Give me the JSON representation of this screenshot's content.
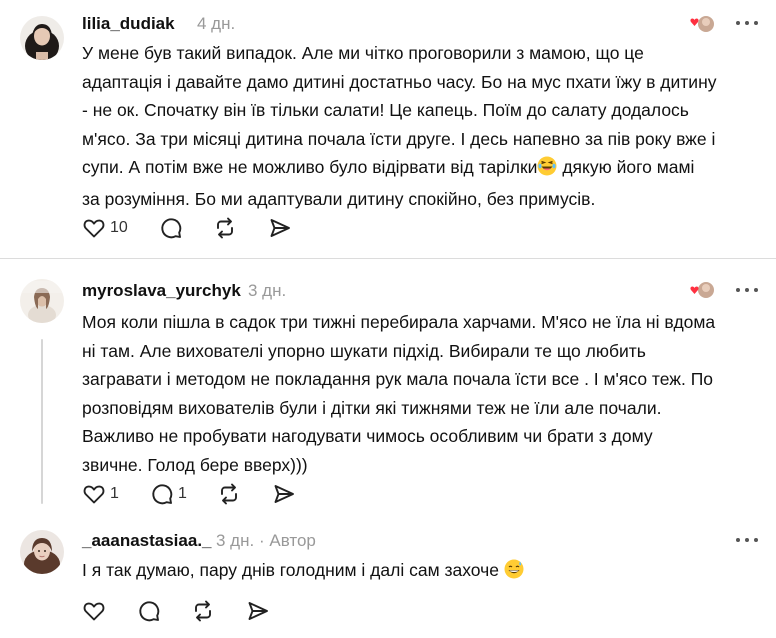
{
  "comments": [
    {
      "username": "lilia_dudiak",
      "time": "4 дн.",
      "text": "У мене був такий випадок. Але ми чітко проговорили з мамою, що це\nадаптація і давайте дамо дитині достатньо часу. Бо на мус пхати їжу в дитину\n- не ок. Спочатку він їв тільки салати! Це капець. Поїм до салату додалось\nм'ясо. За три місяці дитина почала їсти друге. І десь напевно за пів року вже і\nсупи. А потім вже не можливо було відірвати від тарілки",
      "text_tail": " дякую його мамі\nза розуміння. Бо ми адаптували дитину спокійно, без примусів.",
      "emoji": "laughing-face",
      "likes": "10",
      "replies": "",
      "liked_by_author": true
    },
    {
      "username": "myroslava_yurchyk",
      "time": "3 дн.",
      "text": "Моя коли пішла в садок три тижні перебирала харчами. М'ясо не їла ні вдома\nні там. Але вихователі упорно шукати підхід. Вибирали те що любить\nзагравати і методом не покладання рук мала почала їсти все . І м'ясо теж. По\nрозповідям вихователів були і дітки які тижнями теж не їли але почали.\nВажливо не пробувати нагодувати чимось особливим чи брати з дому\nзвичне. Голод бере вверх)))",
      "likes": "1",
      "replies": "1",
      "liked_by_author": true
    },
    {
      "username": "_aaanastasiaa._",
      "time": "3 дн.",
      "separator": "·",
      "author_label": "Автор",
      "text": "І я так думаю, пару днів голодним і далі сам захоче",
      "emoji": "grinning-sweat-face",
      "likes": "",
      "replies": ""
    }
  ],
  "icons": {
    "like": "heart-outline-icon",
    "reply": "speech-bubble-icon",
    "repost": "repost-icon",
    "share": "send-icon",
    "more": "more-dots-icon",
    "liked_by_author": "red-heart-with-avatar-icon"
  },
  "colors": {
    "text": "#111111",
    "muted": "#999999",
    "heart_red": "#ff3040",
    "divider": "#dcdcdc"
  }
}
